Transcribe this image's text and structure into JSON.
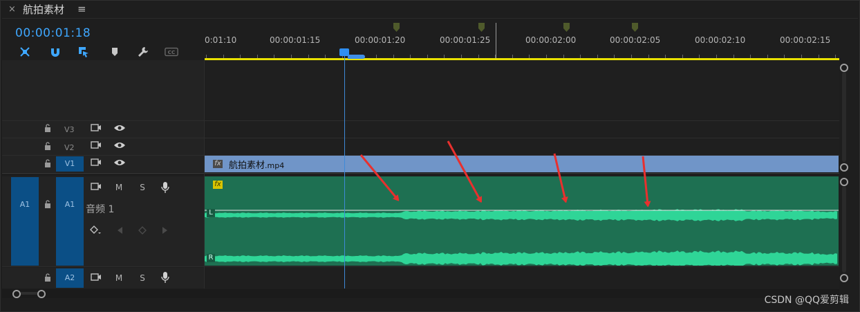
{
  "tab": {
    "title": "航拍素材",
    "close_glyph": "×",
    "menu_glyph": "≡"
  },
  "timecode": "00:00:01:18",
  "tools": [
    "snap-in-icon",
    "magnet-icon",
    "linked-selection-icon",
    "marker-icon",
    "wrench-icon",
    "cc-icon"
  ],
  "ruler": {
    "labels": [
      "0:01:10",
      "00:00:01:15",
      "00:00:01:20",
      "00:00:01:25",
      "00:00:02:00",
      "00:00:02:05",
      "00:00:02:10",
      "00:00:02:15"
    ]
  },
  "tracks": {
    "v3": {
      "name": "V3"
    },
    "v2": {
      "name": "V2"
    },
    "v1": {
      "name": "V1"
    },
    "a1": {
      "target": "A1",
      "name": "A1",
      "label": "音频 1",
      "m": "M",
      "s": "S"
    },
    "a2": {
      "name": "A2",
      "m": "M",
      "s": "S"
    }
  },
  "clips": {
    "video": {
      "name": "航拍素材",
      "ext": ".mp4",
      "fx": "fx"
    },
    "audio": {
      "fx": "fx",
      "channel_l": "L",
      "channel_r": "R"
    }
  },
  "watermark": "CSDN @QQ爱剪辑",
  "colors": {
    "timecode": "#3ea7ff",
    "work_area": "#e8e100",
    "video_clip": "#7095c8",
    "audio_clip": "#1e7052",
    "waveform": "#2fd597",
    "arrow": "#e8302e",
    "track_target": "#0b4f86"
  }
}
